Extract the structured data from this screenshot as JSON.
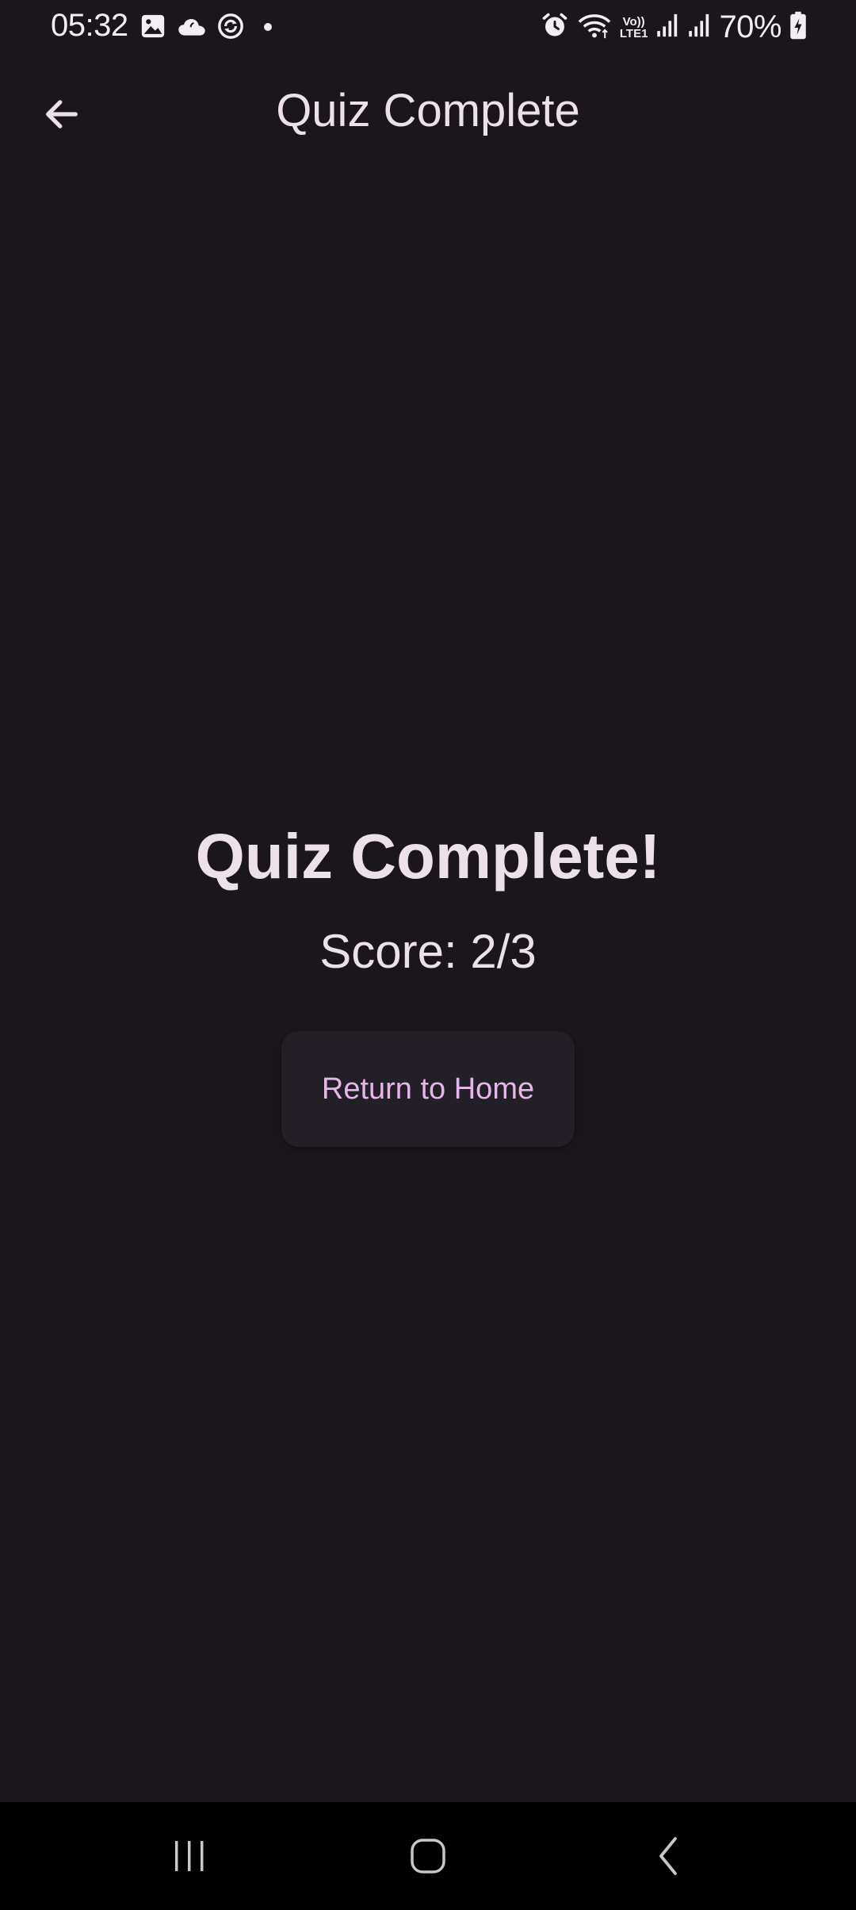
{
  "status_bar": {
    "time": "05:32",
    "battery": "70%",
    "network_label_top": "Vo))",
    "network_label_bottom": "LTE1",
    "icons": [
      "image-icon",
      "cloud-icon",
      "sync-icon",
      "dot-icon",
      "alarm-icon",
      "wifi-icon",
      "volte-icon",
      "signal-icon",
      "signal-icon",
      "battery-charging-icon"
    ]
  },
  "app_bar": {
    "title": "Quiz Complete",
    "back_icon": "arrow-back-icon"
  },
  "main": {
    "heading": "Quiz Complete!",
    "score": "Score: 2/3",
    "home_button_label": "Return to Home"
  },
  "nav_bar": {
    "icons": [
      "recents-icon",
      "home-icon",
      "back-icon"
    ]
  },
  "colors": {
    "background": "#1a161b",
    "text": "#ece0ea",
    "accent": "#e5b6e9",
    "button_surface": "#231f26",
    "nav_bar": "#000000"
  }
}
